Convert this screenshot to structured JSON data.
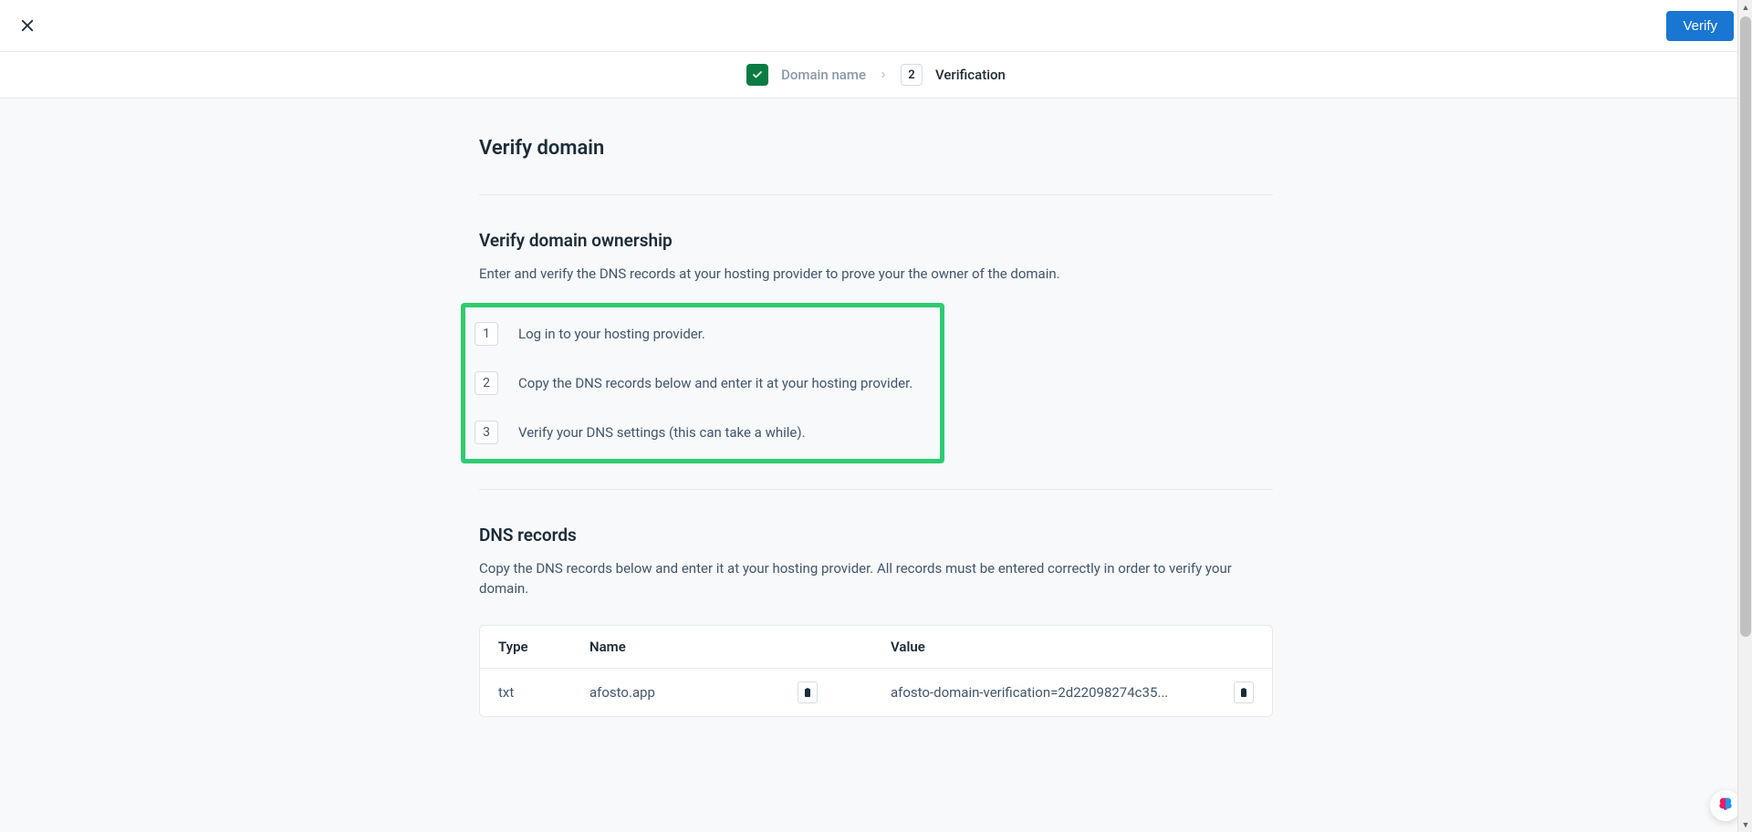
{
  "header": {
    "verify_button": "Verify"
  },
  "stepper": {
    "step1_label": "Domain name",
    "step2_number": "2",
    "step2_label": "Verification"
  },
  "page": {
    "title": "Verify domain"
  },
  "ownership": {
    "title": "Verify domain ownership",
    "description": "Enter and verify the DNS records at your hosting provider to prove your the owner of the domain.",
    "steps": [
      {
        "num": "1",
        "text": "Log in to your hosting provider."
      },
      {
        "num": "2",
        "text": "Copy the DNS records below and enter it at your hosting provider."
      },
      {
        "num": "3",
        "text": "Verify your DNS settings (this can take a while)."
      }
    ]
  },
  "dns": {
    "title": "DNS records",
    "description": "Copy the DNS records below and enter it at your hosting provider. All records must be entered correctly in order to verify your domain.",
    "headers": {
      "type": "Type",
      "name": "Name",
      "value": "Value"
    },
    "record": {
      "type": "txt",
      "name": "afosto.app",
      "value": "afosto-domain-verification=2d22098274c35..."
    }
  }
}
